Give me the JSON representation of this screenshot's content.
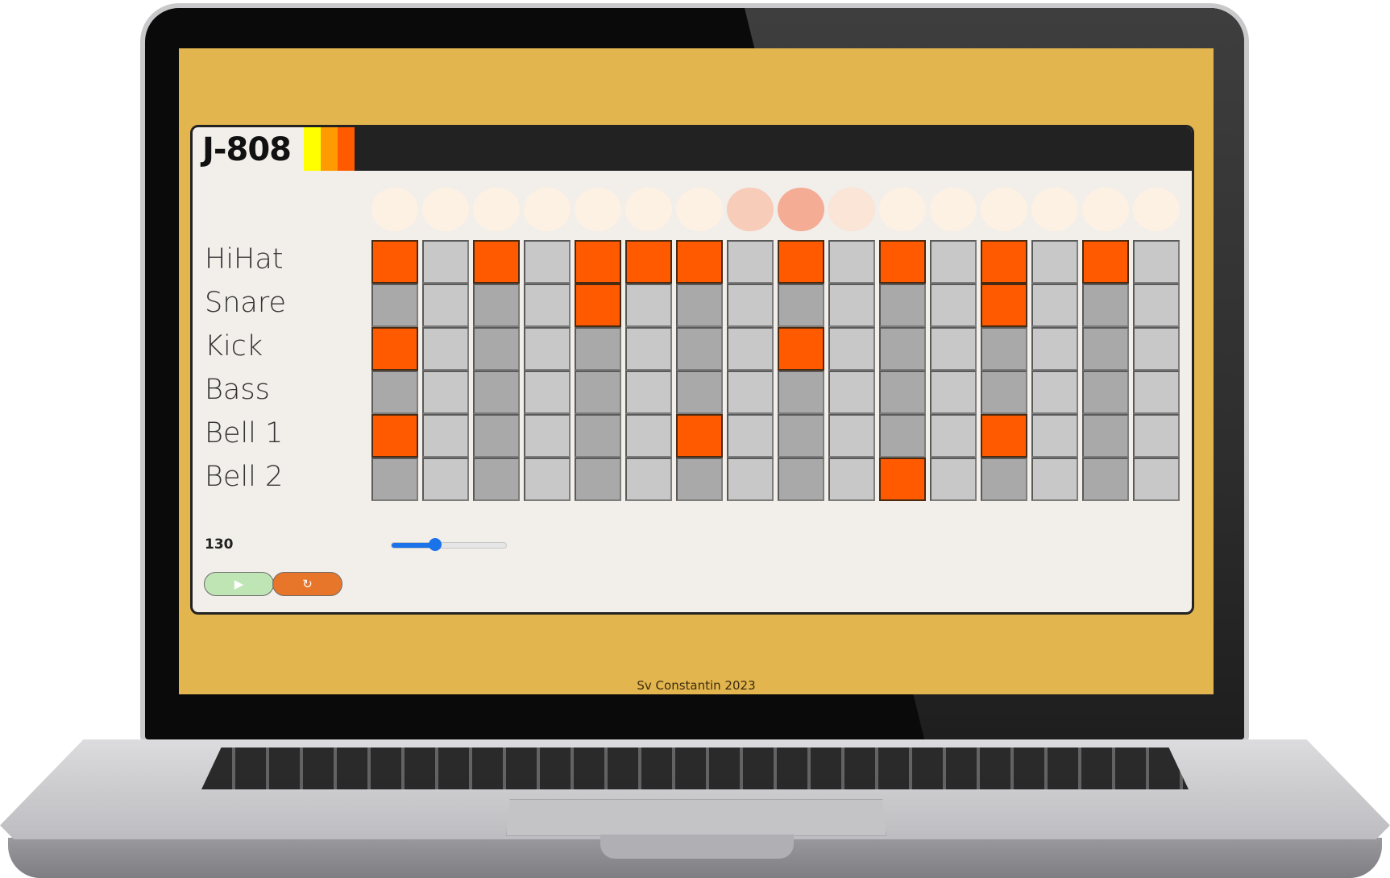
{
  "app": {
    "title": "J-808",
    "stripe_colors": [
      "#ffff00",
      "#ff9a00",
      "#ff5a00"
    ],
    "colors": {
      "pad_on": "#ff5a00",
      "pad_off_dark": "#a9a9a9",
      "pad_off_light": "#c8c8c8",
      "screen_bg": "#e3b54e",
      "panel_bg": "#f2eee9"
    }
  },
  "steps": {
    "count": 16,
    "highlight_levels": [
      0,
      0,
      0,
      0,
      0,
      0,
      0,
      0.55,
      0.75,
      0.3,
      0,
      0,
      0,
      0,
      0,
      0
    ]
  },
  "tracks": [
    {
      "label": "HiHat",
      "pattern": [
        1,
        0,
        1,
        0,
        1,
        1,
        1,
        0,
        1,
        0,
        1,
        0,
        1,
        0,
        1,
        0
      ]
    },
    {
      "label": "Snare",
      "pattern": [
        0,
        0,
        0,
        0,
        1,
        0,
        0,
        0,
        0,
        0,
        0,
        0,
        1,
        0,
        0,
        0
      ]
    },
    {
      "label": "Kick",
      "pattern": [
        1,
        0,
        0,
        0,
        0,
        0,
        0,
        0,
        1,
        0,
        0,
        0,
        0,
        0,
        0,
        0
      ]
    },
    {
      "label": "Bass",
      "pattern": [
        0,
        0,
        0,
        0,
        0,
        0,
        0,
        0,
        0,
        0,
        0,
        0,
        0,
        0,
        0,
        0
      ]
    },
    {
      "label": "Bell 1",
      "pattern": [
        1,
        0,
        0,
        0,
        0,
        0,
        1,
        0,
        0,
        0,
        0,
        0,
        1,
        0,
        0,
        0
      ]
    },
    {
      "label": "Bell 2",
      "pattern": [
        0,
        0,
        0,
        0,
        0,
        0,
        0,
        0,
        0,
        0,
        1,
        0,
        0,
        0,
        0,
        0
      ]
    }
  ],
  "tempo": {
    "value": "130",
    "slider_fraction": 0.38
  },
  "buttons": {
    "play_icon": "▶",
    "play_icon_name": "play-icon",
    "play_color": "#bfe5b5",
    "reset_icon": "↻",
    "reset_icon_name": "reset-icon",
    "reset_color": "#e8762a"
  },
  "footer": {
    "text": "Sv Constantin  2023"
  }
}
